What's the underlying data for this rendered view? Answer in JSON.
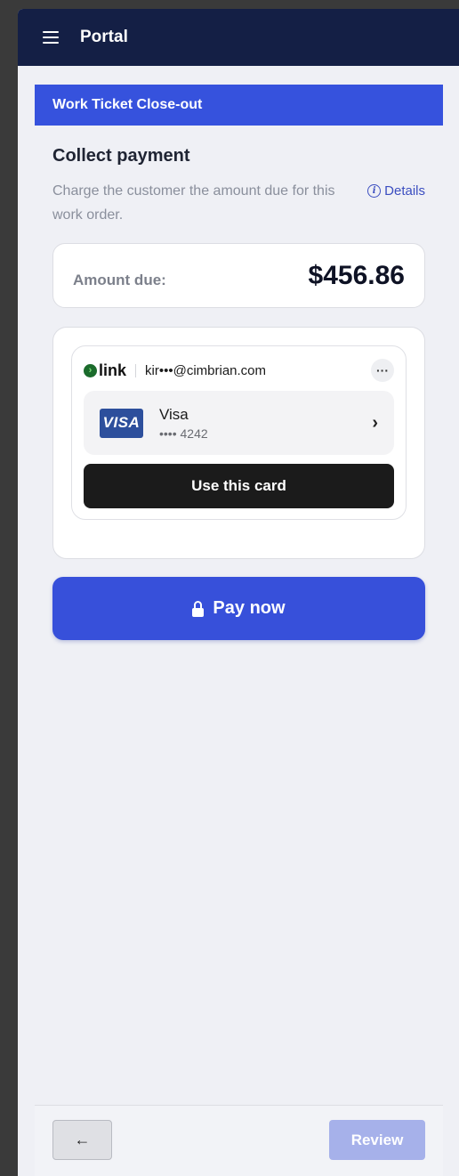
{
  "app": {
    "title": "Portal",
    "menu_icon": "hamburger-menu-icon"
  },
  "section": {
    "title": "Work Ticket Close-out"
  },
  "payment": {
    "heading": "Collect payment",
    "description": "Charge the customer the amount due for this work order.",
    "details_label": "Details",
    "amount_label": "Amount due:",
    "amount_value": "$456.86"
  },
  "link": {
    "logo_text": "link",
    "email": "kir•••@cimbrian.com",
    "more_label": "···",
    "card": {
      "brand_badge": "VISA",
      "brand": "Visa",
      "number": "•••• 4242"
    },
    "use_card_label": "Use this card"
  },
  "actions": {
    "pay_label": "Pay now",
    "back_label": "←",
    "review_label": "Review"
  },
  "colors": {
    "topbar": "#141f45",
    "accent": "#3652dd",
    "review_disabled": "#a6b1ea",
    "link_green": "#1b6b2c"
  }
}
